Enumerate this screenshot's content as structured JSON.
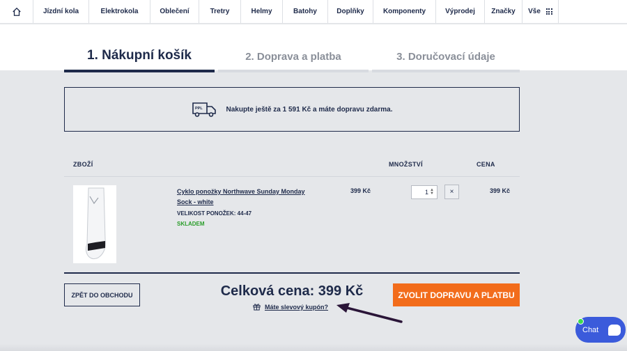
{
  "nav": {
    "items": [
      "Jízdní kola",
      "Elektrokola",
      "Oblečení",
      "Tretry",
      "Helmy",
      "Batohy",
      "Doplňky",
      "Komponenty",
      "Výprodej",
      "Značky"
    ],
    "all_label": "Vše",
    "home_icon": "home-icon",
    "grid_icon": "grid-icon"
  },
  "steps": [
    {
      "label": "1. Nákupní košík",
      "active": true
    },
    {
      "label": "2. Doprava a platba",
      "active": false
    },
    {
      "label": "3. Doručovací údaje",
      "active": false
    }
  ],
  "shipping_notice": {
    "icon": "delivery-truck-icon",
    "truck_label": "PPL",
    "text": "Nakupte ještě za 1 591 Kč a máte dopravu zdarma."
  },
  "table": {
    "col_item": "ZBOŽÍ",
    "col_qty": "MNOŽSTVÍ",
    "col_price": "CENA"
  },
  "cart_item": {
    "name_line1": "Cyklo ponožky Northwave Sunday Monday",
    "name_line2": "Sock - white",
    "attribute": "VELIKOST PONOŽEK: 44-47",
    "stock": "SKLADEM",
    "unit_price": "399 Kč",
    "quantity": "1",
    "remove_label": "×",
    "line_price": "399 Kč"
  },
  "footer": {
    "back_label": "ZPĚT DO OBCHODU",
    "total": "Celková cena: 399 Kč",
    "coupon": "Máte slevový kupón?",
    "coupon_icon": "gift-icon",
    "cta": "ZVOLIT DOPRAVU A PLATBU"
  },
  "chat": {
    "label": "Chat",
    "icon": "chat-bubble-icon"
  },
  "colors": {
    "navy": "#1e2a4a",
    "orange": "#f26c1b",
    "green": "#2a9d2a",
    "chat_blue": "#3b5bdb"
  }
}
